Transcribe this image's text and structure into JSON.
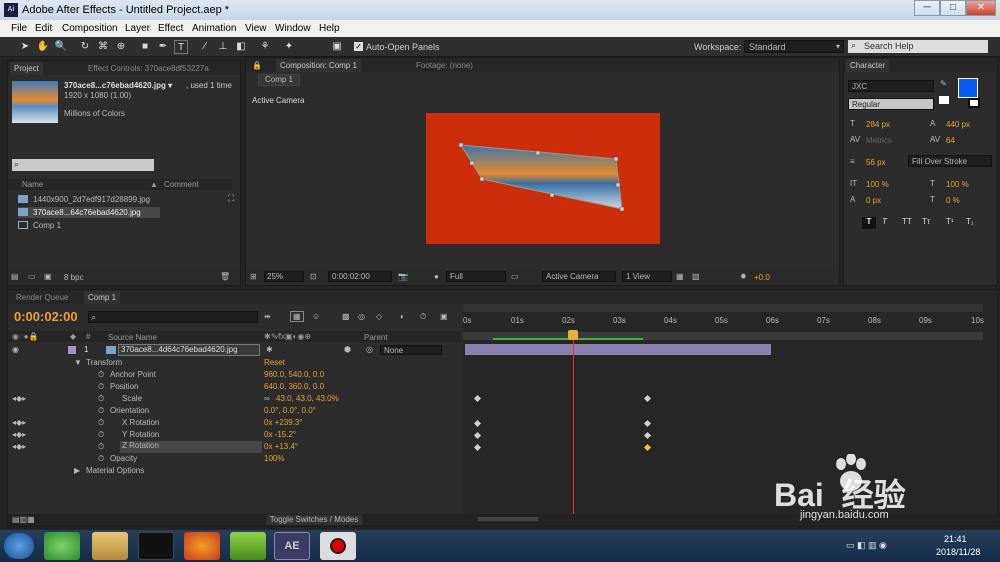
{
  "window": {
    "title": "Adobe After Effects - Untitled Project.aep *",
    "app_icon": "Ai",
    "controls": [
      "─",
      "□",
      "✕"
    ]
  },
  "menu": [
    "File",
    "Edit",
    "Composition",
    "Layer",
    "Effect",
    "Animation",
    "View",
    "Window",
    "Help"
  ],
  "toolbar": {
    "auto_open": "Auto-Open Panels",
    "workspace_label": "Workspace:",
    "workspace_value": "Standard",
    "search_help": "Search Help"
  },
  "project": {
    "tab": "Project",
    "tab_effects": "Effect Controls: 370ace8df53227a",
    "file_name": "370ace8...c76ebad4620.jpg ▾",
    "used": ", used 1 time",
    "dims": "1920 x 1080 (1.00)",
    "colors": "Millions of Colors",
    "col_name": "Name",
    "col_comment": "Comment",
    "items": [
      "1440x900_2d7edf917d28899.jpg",
      "370ace8...64c76ebad4620.jpg",
      "Comp 1"
    ],
    "bpc": "8 bpc"
  },
  "composition": {
    "tab": "Composition: Comp 1",
    "tab_footage": "Footage: (none)",
    "subtab": "Comp 1",
    "camera_label": "Active Camera",
    "zoom": "25%",
    "time": "0:00:02:00",
    "resolution": "Full",
    "camera": "Active Camera",
    "views": "1 View",
    "offset": "+0.0"
  },
  "character": {
    "tab": "Character",
    "font": "JXC",
    "style": "Regular",
    "size": "284 px",
    "leading": "440 px",
    "kerning": "Metrics",
    "tracking": "64",
    "stroke": "56 px",
    "stroke_mode": "Fill Over Stroke",
    "vscale": "100 %",
    "hscale": "100 %",
    "baseline": "0 px",
    "tsume": "0 %",
    "fill_color": "#0a5cf5",
    "styles": [
      "T",
      "T",
      "TT",
      "Tт",
      "T¹",
      "T₁"
    ]
  },
  "timeline": {
    "tab_render": "Render Queue",
    "tab_comp": "Comp 1",
    "timecode": "0:00:02:00",
    "col_source": "Source Name",
    "col_parent": "Parent",
    "layer_num": "1",
    "layer_name": "370ace8...4d64c76ebad4620.jpg",
    "parent": "None",
    "props": [
      {
        "name": "Transform",
        "value": "Reset"
      },
      {
        "name": "Anchor Point",
        "value": "960.0, 540.0, 0.0"
      },
      {
        "name": "Position",
        "value": "640.0, 360.0, 0.0"
      },
      {
        "name": "Scale",
        "value": "43.0, 43.0, 43.0%"
      },
      {
        "name": "Orientation",
        "value": "0.0°, 0.0°, 0.0°"
      },
      {
        "name": "X Rotation",
        "value": "0x +239.3°"
      },
      {
        "name": "Y Rotation",
        "value": "0x -15.2°"
      },
      {
        "name": "Z Rotation",
        "value": "0x +13.4°"
      },
      {
        "name": "Opacity",
        "value": "100%"
      },
      {
        "name": "Material Options",
        "value": ""
      }
    ],
    "ruler": [
      "0s",
      "01s",
      "02s",
      "03s",
      "04s",
      "05s",
      "06s",
      "07s",
      "08s",
      "09s",
      "10s"
    ],
    "toggle": "Toggle Switches / Modes"
  },
  "taskbar": {
    "time": "21:41",
    "date": "2018/11/28",
    "ae": "AE"
  },
  "watermark": {
    "brand": "Bai  经验",
    "url": "jingyan.baidu.com"
  }
}
